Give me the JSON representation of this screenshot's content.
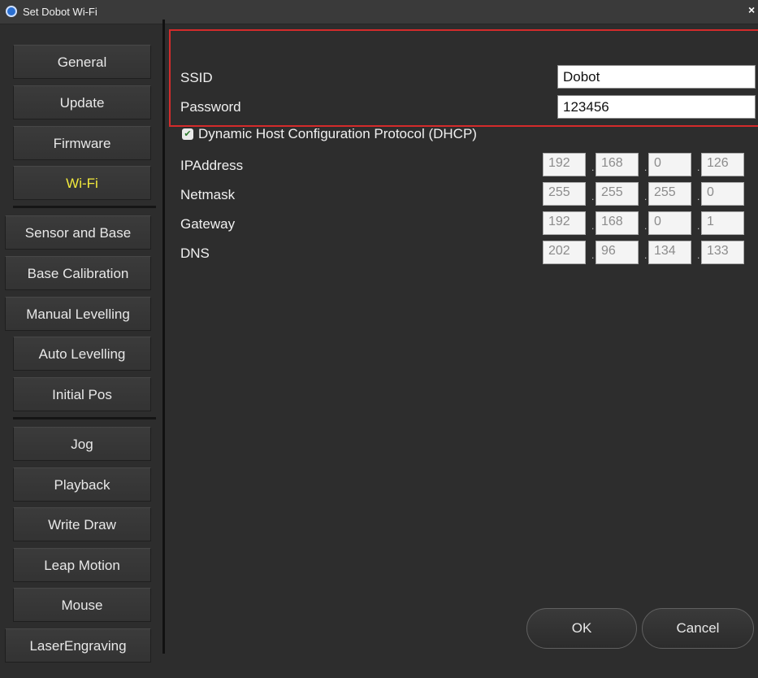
{
  "window": {
    "title": "Set Dobot Wi-Fi",
    "close_glyph": "×"
  },
  "sidebar": {
    "items": [
      {
        "label": "General"
      },
      {
        "label": "Update"
      },
      {
        "label": "Firmware"
      },
      {
        "label": "Wi-Fi"
      },
      {
        "label": "Sensor and Base"
      },
      {
        "label": "Base Calibration"
      },
      {
        "label": "Manual Levelling"
      },
      {
        "label": "Auto Levelling"
      },
      {
        "label": "Initial Pos"
      },
      {
        "label": "Jog"
      },
      {
        "label": "Playback"
      },
      {
        "label": "Write  Draw"
      },
      {
        "label": "Leap Motion"
      },
      {
        "label": "Mouse"
      },
      {
        "label": "LaserEngraving"
      }
    ],
    "active_item": "Wi-Fi",
    "active_color": "#f2ea3c"
  },
  "form": {
    "ssid": {
      "label": "SSID",
      "value": "Dobot"
    },
    "password": {
      "label": "Password",
      "value": "123456"
    },
    "dhcp": {
      "label": "Dynamic Host Configuration Protocol (DHCP)",
      "checked": true
    },
    "ip": {
      "label": "IPAddress",
      "octets": [
        "192",
        "168",
        "0",
        "126"
      ]
    },
    "netmask": {
      "label": "Netmask",
      "octets": [
        "255",
        "255",
        "255",
        "0"
      ]
    },
    "gateway": {
      "label": "Gateway",
      "octets": [
        "192",
        "168",
        "0",
        "1"
      ]
    },
    "dns": {
      "label": "DNS",
      "octets": [
        "202",
        "96",
        "134",
        "133"
      ]
    }
  },
  "buttons": {
    "ok": "OK",
    "cancel": "Cancel"
  },
  "colors": {
    "highlight_border": "#d42b2b",
    "background": "#2d2d2d"
  }
}
